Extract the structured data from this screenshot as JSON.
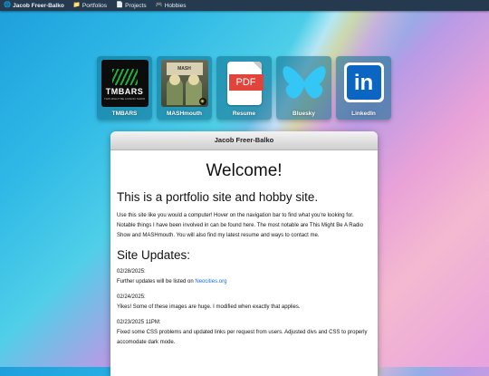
{
  "menubar": {
    "items": [
      {
        "label": "Jacob Freer-Balko",
        "icon": "globe-icon"
      },
      {
        "label": "Portfolios",
        "icon": "folder-icon"
      },
      {
        "label": "Projects",
        "icon": "document-icon"
      },
      {
        "label": "Hobbies",
        "icon": "gamepad-icon"
      }
    ]
  },
  "desktop_icons": [
    {
      "label": "TMBARS",
      "icon": "tmbars-logo-icon",
      "logo_text": "TMBARS",
      "logo_sub": "THIS MIGHT BE A RADIO SHOW"
    },
    {
      "label": "MASHmouth",
      "icon": "mashmouth-album-icon",
      "logo_text": "MASH"
    },
    {
      "label": "Resume",
      "icon": "pdf-icon",
      "logo_text": "PDF"
    },
    {
      "label": "Bluesky",
      "icon": "bluesky-butterfly-icon"
    },
    {
      "label": "LinkedIn",
      "icon": "linkedin-icon",
      "logo_text": "in"
    }
  ],
  "window": {
    "title": "Jacob Freer-Balko",
    "welcome": "Welcome!",
    "subhead": "This is a portfolio site and hobby site.",
    "intro1": "Use this site like you would a computer! Hover on the navigation bar to find what you're looking for.",
    "intro2": "Notable things I have been involved in can be found here. The most notable are This Might Be A Radio Show and MASHmouth. You will also find my latest resume and ways to contact me.",
    "updates_heading": "Site Updates:",
    "updates": [
      {
        "date": "02/28/2025:",
        "text_before": "Further updates will be listed on ",
        "link": "Neocities.org",
        "text_after": ""
      },
      {
        "date": "02/24/2025:",
        "text": "Yikes! Some of these images are huge. I modified when exactly that applies."
      },
      {
        "date": "02/23/2025 11PM:",
        "text": "Fixed some CSS problems and updated links per request from users. Adjusted divs and CSS to properly accomodate dark mode."
      }
    ]
  },
  "colors": {
    "menubar": "#263a4f",
    "link": "#1a6fd6",
    "linkedin": "#0a66c2",
    "bluesky": "#1d9bf0",
    "pdf_red": "#e0443a",
    "tmbars_green": "#1fae3b"
  }
}
